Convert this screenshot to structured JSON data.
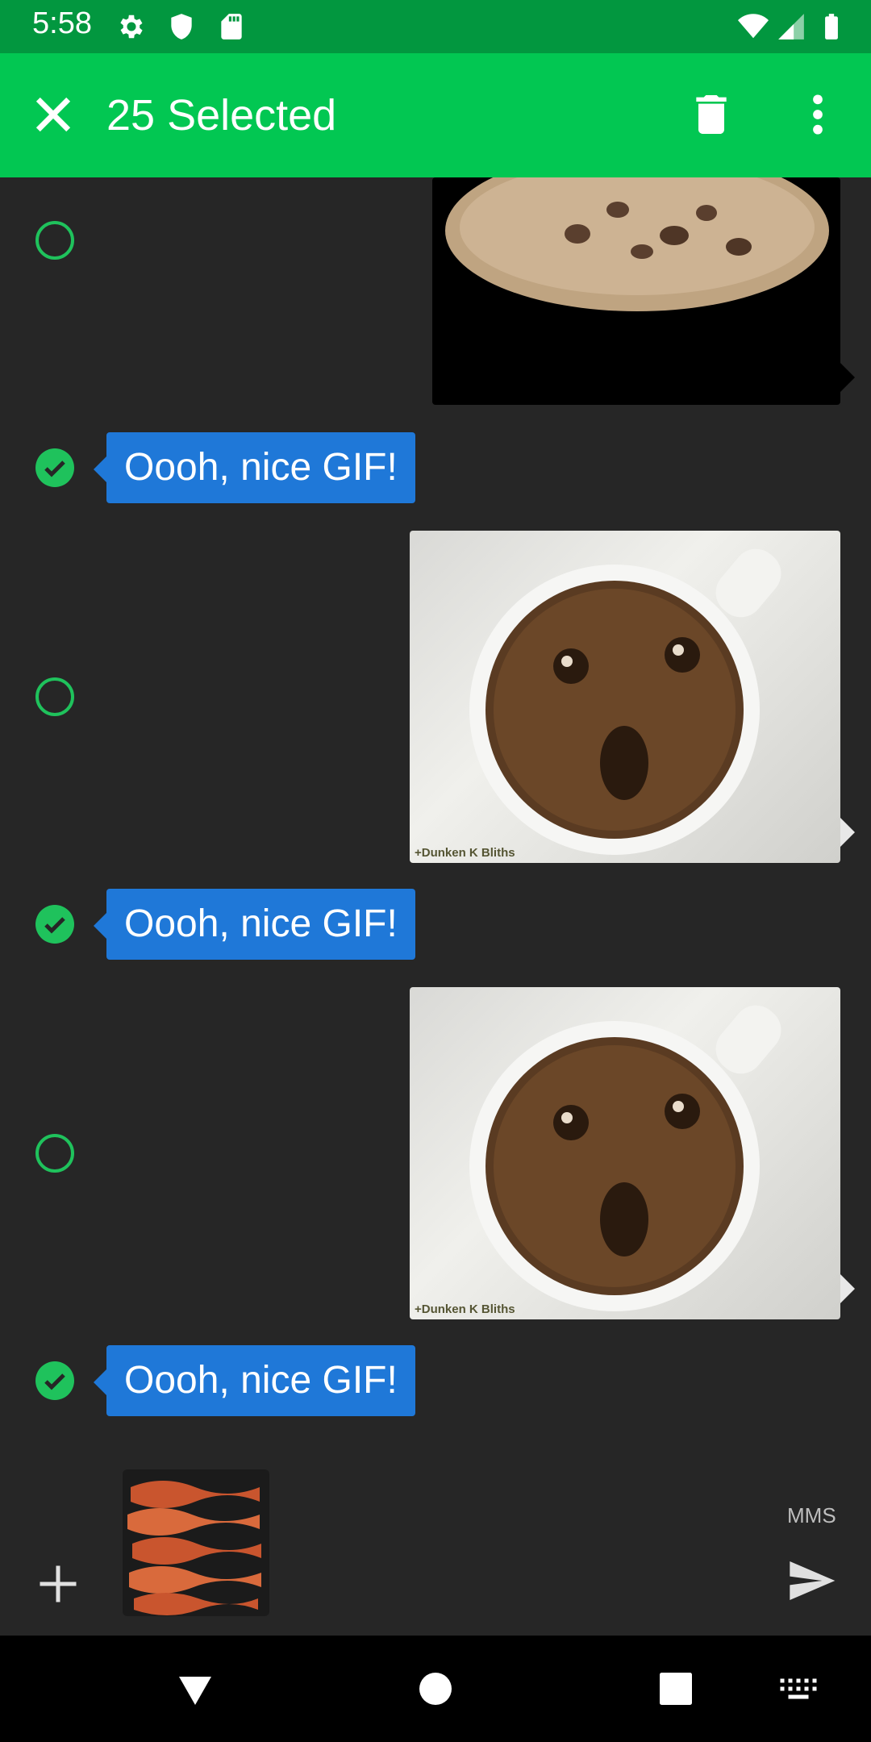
{
  "status_bar": {
    "time": "5:58",
    "left_icons": [
      "gear-icon",
      "shield-icon",
      "sd-card-icon"
    ],
    "right_icons": [
      "wifi-icon",
      "signal-icon",
      "battery-icon"
    ]
  },
  "toolbar": {
    "title": "25 Selected",
    "actions": [
      "close-icon",
      "delete-icon",
      "more-vert-icon"
    ],
    "color": "#02c752"
  },
  "messages": [
    {
      "type": "image",
      "direction": "incoming",
      "selected": false,
      "description": "cookie-gif"
    },
    {
      "type": "text",
      "direction": "outgoing",
      "selected": true,
      "text": "Oooh, nice GIF!"
    },
    {
      "type": "image",
      "direction": "incoming",
      "selected": false,
      "watermark": "+Dunken K Bliths"
    },
    {
      "type": "text",
      "direction": "outgoing",
      "selected": true,
      "text": "Oooh, nice GIF!"
    },
    {
      "type": "image",
      "direction": "incoming",
      "selected": false,
      "watermark": "+Dunken K Bliths"
    },
    {
      "type": "text",
      "direction": "outgoing",
      "selected": true,
      "text": "Oooh, nice GIF!"
    }
  ],
  "compose": {
    "attachment": "bacon-image",
    "send_mode": "MMS",
    "icons": [
      "add-icon",
      "send-icon"
    ]
  },
  "nav_bar": {
    "icons": [
      "back-icon",
      "home-icon",
      "recents-icon",
      "keyboard-icon"
    ]
  },
  "colors": {
    "accent": "#02c752",
    "status_bar": "#02973f",
    "bubble": "#1f78d8",
    "background": "#262626"
  }
}
